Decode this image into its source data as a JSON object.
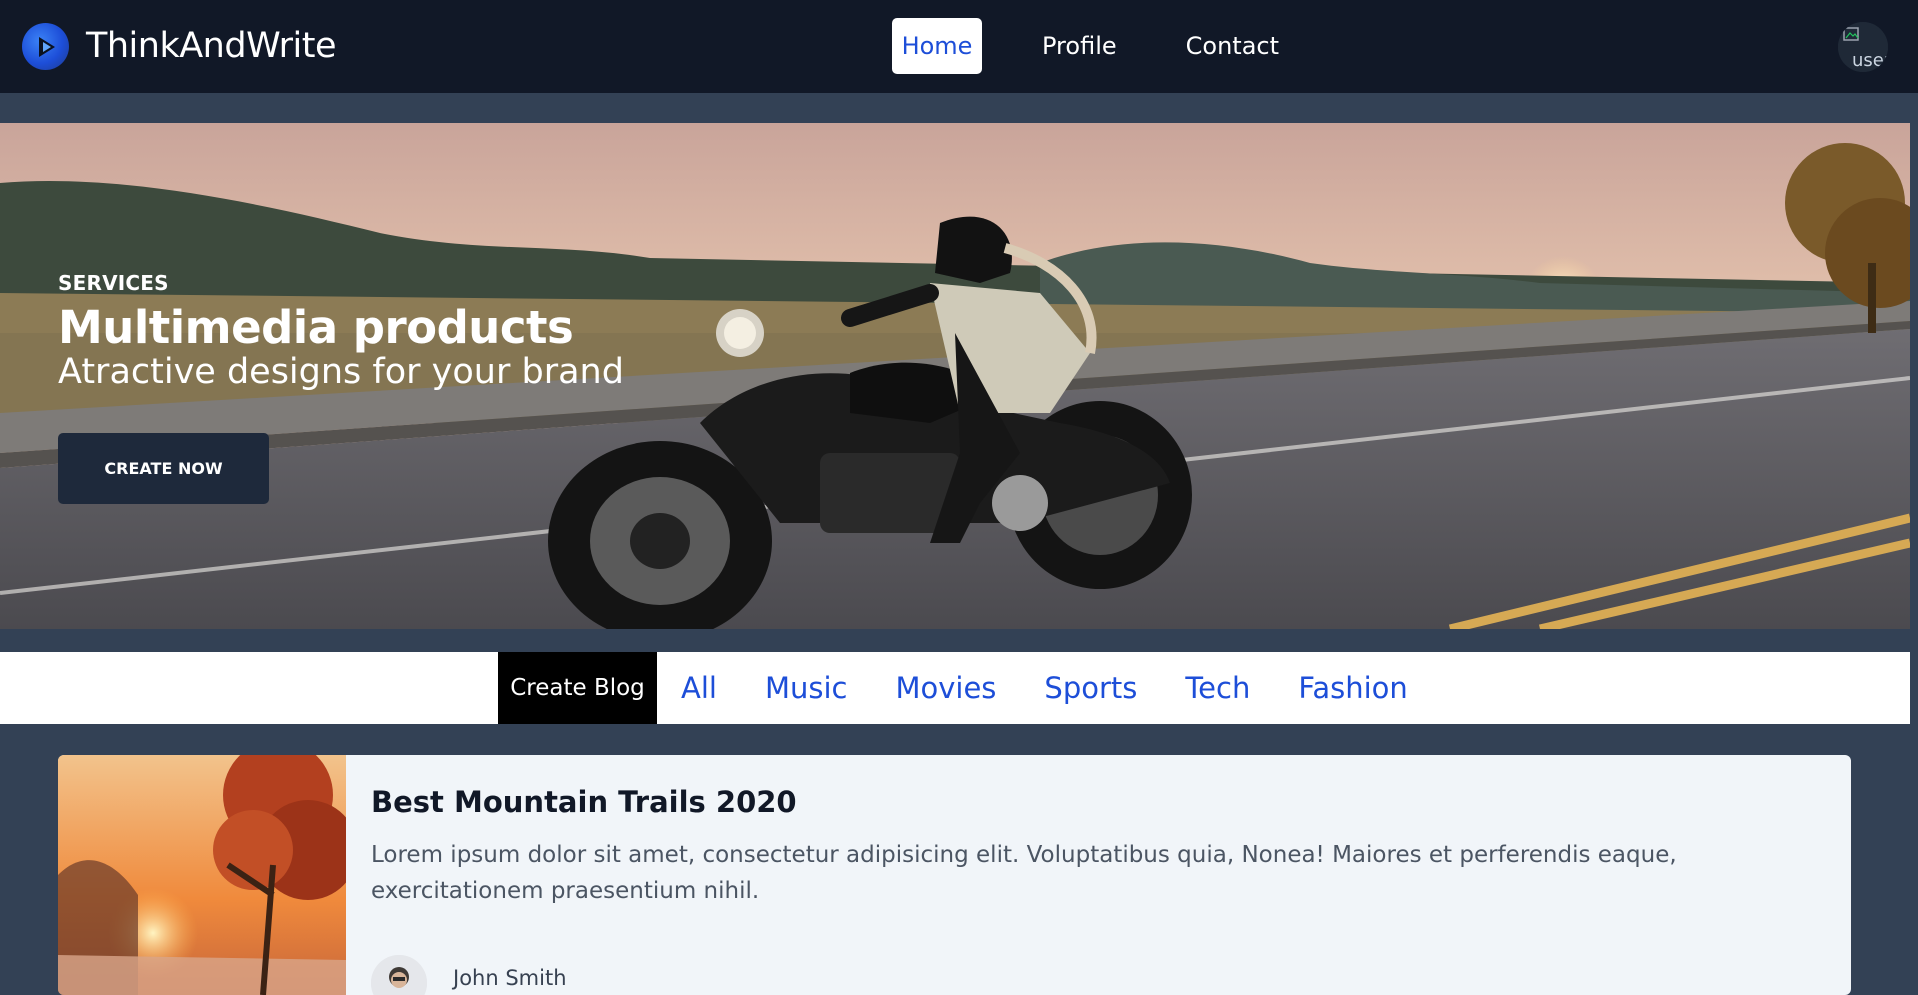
{
  "navbar": {
    "brand": "ThinkAndWrite",
    "brand_icon": "play-logo-icon",
    "links": [
      "Home",
      "Profile",
      "Contact"
    ],
    "active_link": "Home",
    "avatar_alt": "user"
  },
  "hero": {
    "kicker": "SERVICES",
    "title": "Multimedia products",
    "subtitle": "Atractive designs for your brand",
    "cta": "CREATE NOW"
  },
  "categories": {
    "create_label": "Create Blog",
    "items": [
      "All",
      "Music",
      "Movies",
      "Sports",
      "Tech",
      "Fashion"
    ]
  },
  "posts": [
    {
      "title": "Best Mountain Trails 2020",
      "excerpt": "Lorem ipsum dolor sit amet, consectetur adipisicing elit. Voluptatibus quia, Nonea! Maiores et perferendis eaque, exercitationem praesentium nihil.",
      "author": "John Smith"
    }
  ],
  "colors": {
    "nav_bg": "#111827",
    "page_bg": "#334155",
    "accent": "#1d4ed8",
    "button_dark": "#1e293b",
    "card_bg": "#f1f5f9"
  }
}
